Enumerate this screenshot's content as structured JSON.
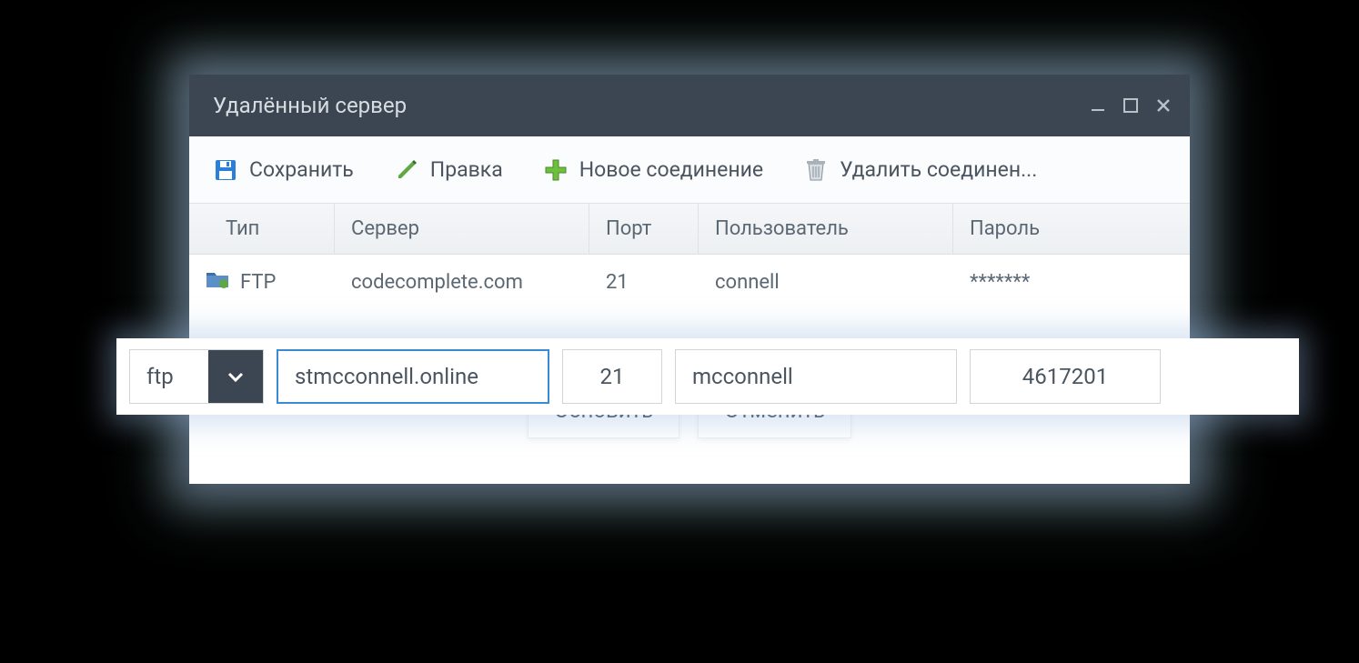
{
  "window": {
    "title": "Удалённый сервер"
  },
  "toolbar": {
    "save_label": "Сохранить",
    "edit_label": "Правка",
    "new_label": "Новое соединение",
    "delete_label": "Удалить соединен..."
  },
  "headers": {
    "type": "Тип",
    "server": "Сервер",
    "port": "Порт",
    "user": "Пользователь",
    "password": "Пароль"
  },
  "rows": [
    {
      "type": "FTP",
      "server": "codecomplete.com",
      "port": "21",
      "user": "connell",
      "password": "*******"
    }
  ],
  "edit": {
    "type_value": "ftp",
    "server": "stmcconnell.online",
    "port": "21",
    "user": "mcconnell",
    "password": "4617201"
  },
  "actions": {
    "update": "Обновить",
    "cancel": "Отменить"
  },
  "colors": {
    "titlebar": "#3b4652",
    "accent": "#3b8bd4"
  }
}
